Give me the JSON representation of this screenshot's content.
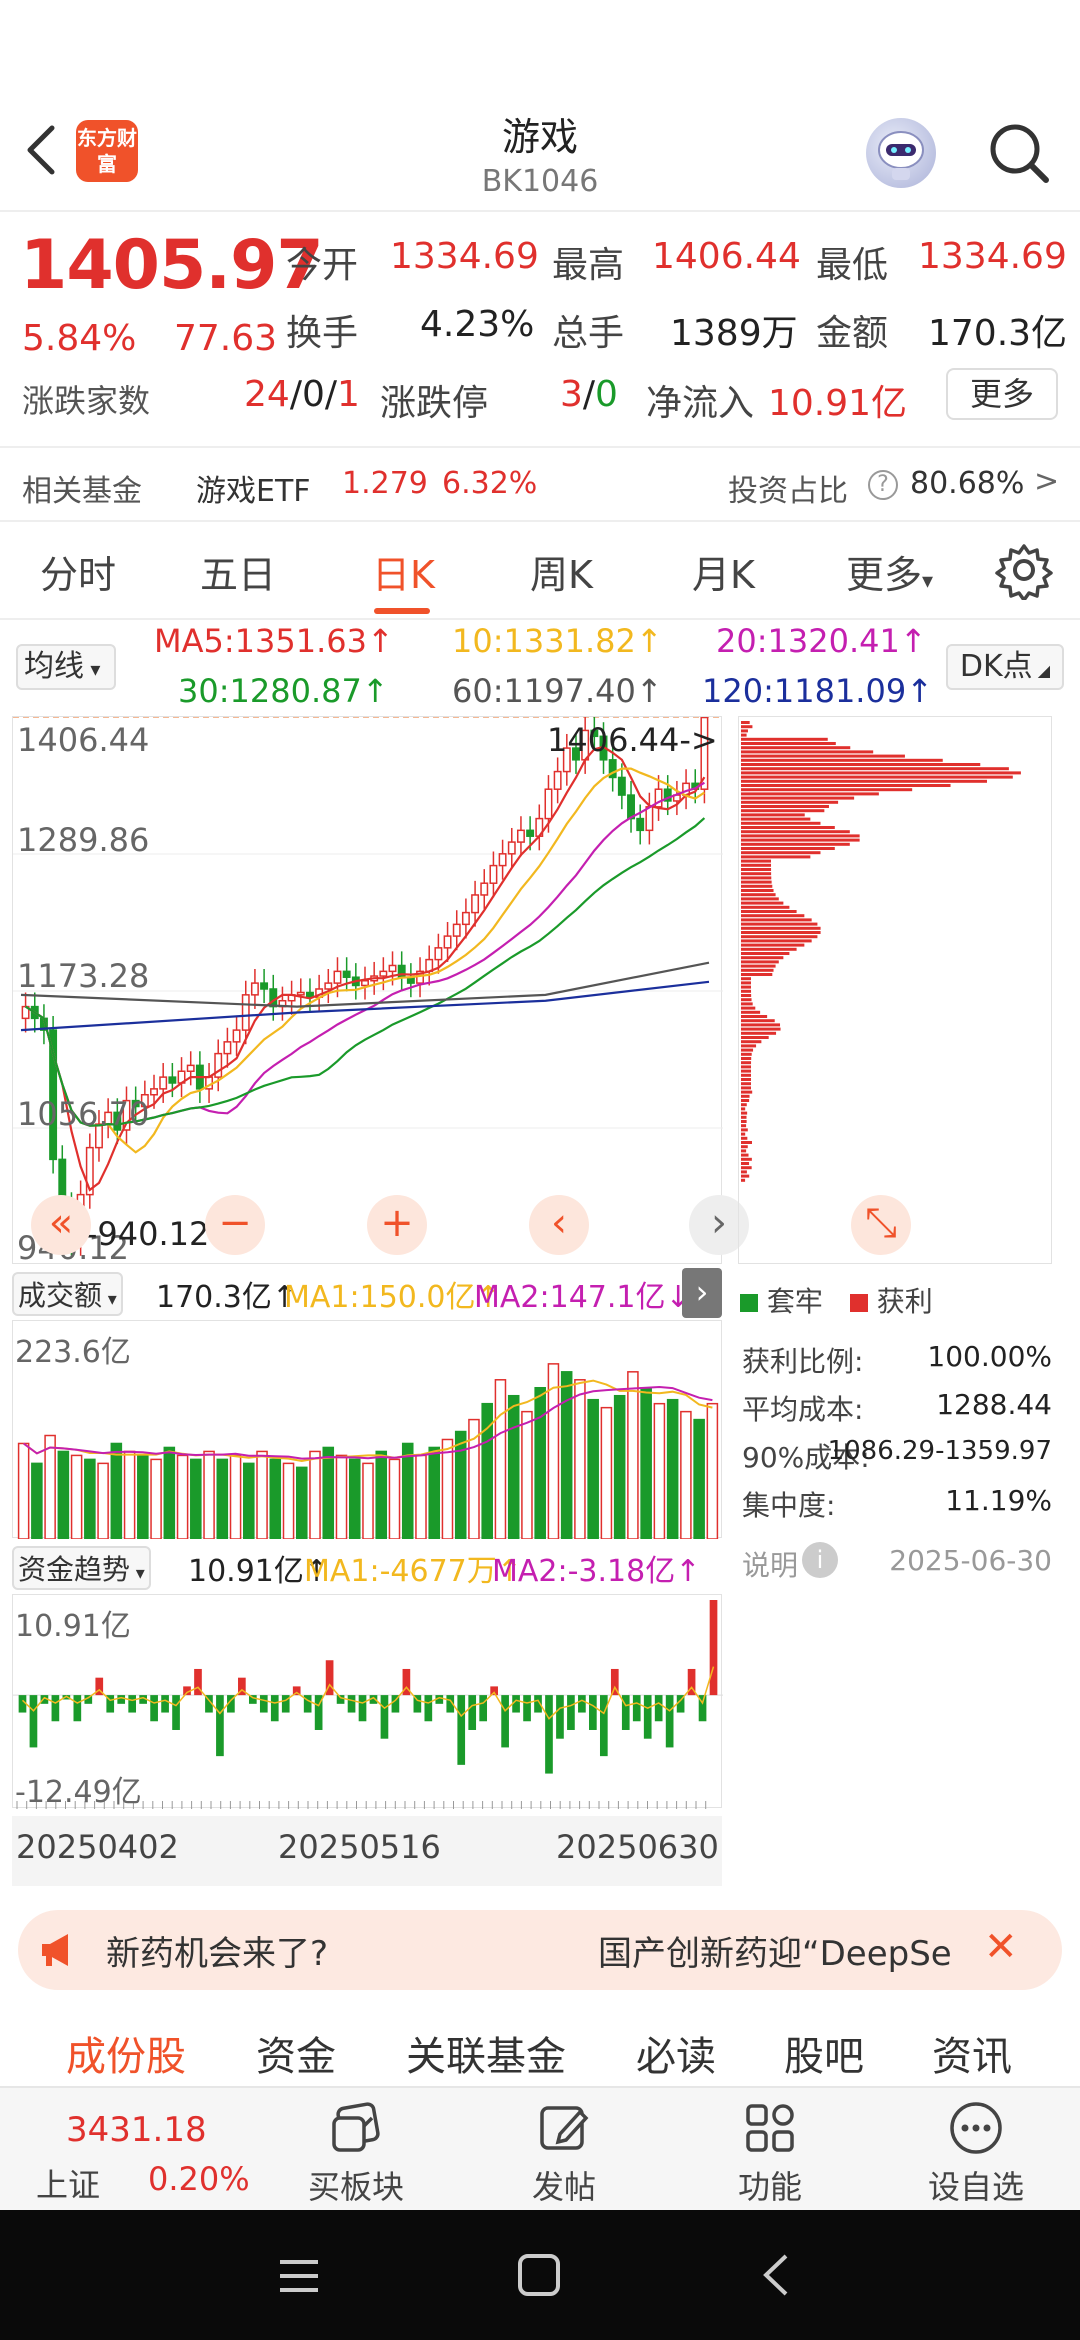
{
  "header": {
    "title": "游戏",
    "code": "BK1046",
    "logo_text": "东方财富"
  },
  "quote": {
    "price": "1405.97",
    "change_pct": "5.84%",
    "change_amt": "77.63",
    "open_label": "今开",
    "open": "1334.69",
    "high_label": "最高",
    "high": "1406.44",
    "low_label": "最低",
    "low": "1334.69",
    "turnover_label": "换手",
    "turnover": "4.23%",
    "volume_label": "总手",
    "volume": "1389万",
    "amount_label": "金额",
    "amount": "170.3亿",
    "breadth_label": "涨跌家数",
    "breadth_up": "24",
    "breadth_flat": "0",
    "breadth_down": "1",
    "limit_label": "涨跌停",
    "limit_up": "3",
    "limit_down": "0",
    "netflow_label": "净流入",
    "netflow": "10.91亿",
    "more_label": "更多"
  },
  "fund": {
    "label": "相关基金",
    "name": "游戏ETF",
    "price": "1.279",
    "pct": "6.32%",
    "ratio_label": "投资占比",
    "ratio": "80.68%"
  },
  "tabs": [
    "分时",
    "五日",
    "日K",
    "周K",
    "月K",
    "更多"
  ],
  "active_tab": "日K",
  "ma": {
    "type_label": "均线",
    "ma5": "MA5:1351.63↑",
    "ma10": "10:1331.82↑",
    "ma20": "20:1320.41↑",
    "ma30": "30:1280.87↑",
    "ma60": "60:1197.40↑",
    "ma120": "120:1181.09↑",
    "dk_label": "DK点",
    "colors": {
      "ma5": "#e0302d",
      "ma10": "#f2b81f",
      "ma20": "#c41fb0",
      "ma30": "#1a9a2a",
      "ma60": "#555555",
      "ma120": "#1b2f9c"
    }
  },
  "kline": {
    "y_top": "1406.44",
    "y_mid1": "1289.86",
    "y_mid2": "1173.28",
    "y_mid3": "1056.70",
    "y_bottom": "940.12",
    "high_annot": "1406.44->",
    "low_annot": "<-940.12"
  },
  "volume": {
    "label": "成交额",
    "value": "170.3亿↑",
    "ma1": "MA1:150.0亿↑",
    "ma2": "MA2:147.1亿↓",
    "y_max": "223.6亿"
  },
  "flow": {
    "label": "资金趋势",
    "value": "10.91亿↑",
    "ma1": "MA1:-4677万↑",
    "ma2": "MA2:-3.18亿↑",
    "y_max": "10.91亿",
    "y_min": "-12.49亿"
  },
  "dates": [
    "20250402",
    "20250516",
    "20250630"
  ],
  "chip": {
    "legend_trapped": "套牢",
    "legend_profit": "获利",
    "profit_ratio_label": "获利比例:",
    "profit_ratio": "100.00%",
    "avg_cost_label": "平均成本:",
    "avg_cost": "1288.44",
    "cost90_label": "90%成本:",
    "cost90": "1086.29-1359.97",
    "concentration_label": "集中度:",
    "concentration": "11.19%",
    "note_label": "说明",
    "date": "2025-06-30"
  },
  "banner": {
    "text_left": "新药机会来了?",
    "text_right": "国产创新药迎“DeepSe"
  },
  "bottom_tabs": [
    "成份股",
    "资金",
    "关联基金",
    "必读",
    "股吧",
    "资讯"
  ],
  "nav": {
    "index_value": "3431.18",
    "index_name": "上证",
    "index_pct": "0.20%",
    "items": [
      "买板块",
      "发帖",
      "功能",
      "设自选"
    ]
  },
  "chart_data": [
    {
      "type": "candlestick",
      "title": "",
      "xlabel": "",
      "ylabel": "",
      "x": [
        "20250402",
        "20250516",
        "20250630"
      ],
      "ylim": [
        940.12,
        1406.44
      ],
      "yticks": [
        1406.44,
        1289.86,
        1173.28,
        1056.7,
        940.12
      ],
      "series": [
        {
          "name": "MA5",
          "last": 1351.63
        },
        {
          "name": "MA10",
          "last": 1331.82
        },
        {
          "name": "MA20",
          "last": 1320.41
        },
        {
          "name": "MA30",
          "last": 1280.87
        },
        {
          "name": "MA60",
          "last": 1197.4
        },
        {
          "name": "MA120",
          "last": 1181.09
        }
      ],
      "closes": [
        1160,
        1150,
        1140,
        1030,
        990,
        960,
        1000,
        1040,
        1060,
        1070,
        1055,
        1080,
        1075,
        1085,
        1090,
        1100,
        1095,
        1105,
        1110,
        1090,
        1100,
        1120,
        1130,
        1140,
        1170,
        1180,
        1175,
        1160,
        1165,
        1170,
        1172,
        1168,
        1175,
        1180,
        1190,
        1185,
        1178,
        1182,
        1186,
        1190,
        1195,
        1185,
        1180,
        1190,
        1200,
        1210,
        1220,
        1230,
        1240,
        1255,
        1265,
        1280,
        1290,
        1300,
        1310,
        1305,
        1320,
        1345,
        1360,
        1380,
        1370,
        1395,
        1390,
        1370,
        1355,
        1340,
        1320,
        1310,
        1330,
        1345,
        1335,
        1340,
        1350,
        1345,
        1406
      ]
    },
    {
      "type": "bar",
      "title": "成交额",
      "ylim": [
        0,
        223.6
      ],
      "values": [
        120,
        95,
        130,
        110,
        105,
        100,
        95,
        120,
        110,
        105,
        100,
        115,
        105,
        100,
        110,
        100,
        105,
        95,
        110,
        100,
        95,
        90,
        110,
        115,
        105,
        100,
        95,
        110,
        100,
        120,
        105,
        115,
        125,
        135,
        150,
        170,
        200,
        180,
        160,
        190,
        220,
        210,
        200,
        175,
        165,
        180,
        210,
        190,
        170,
        175,
        160,
        150,
        170
      ]
    },
    {
      "type": "bar",
      "title": "资金趋势",
      "ylim": [
        -12.49,
        10.91
      ],
      "values": [
        -2,
        -6,
        -1,
        -3,
        -0.5,
        -3,
        -1,
        2,
        -2,
        -1,
        -2,
        -1,
        -3,
        -2,
        -4,
        1,
        3,
        -2,
        -7,
        -2,
        2,
        -1,
        -2,
        -3,
        -2,
        1,
        -2,
        -4,
        4,
        -1,
        -2,
        -3,
        -1,
        -5,
        -2,
        3,
        -2,
        -3,
        -1,
        -2,
        -8,
        -4,
        -3,
        1,
        -6,
        -2,
        -3,
        -2,
        -9,
        -5,
        -4,
        -2,
        -4,
        -7,
        3,
        -4,
        -3,
        -5,
        -3,
        -6,
        -2,
        3,
        -3,
        10.91
      ]
    }
  ]
}
